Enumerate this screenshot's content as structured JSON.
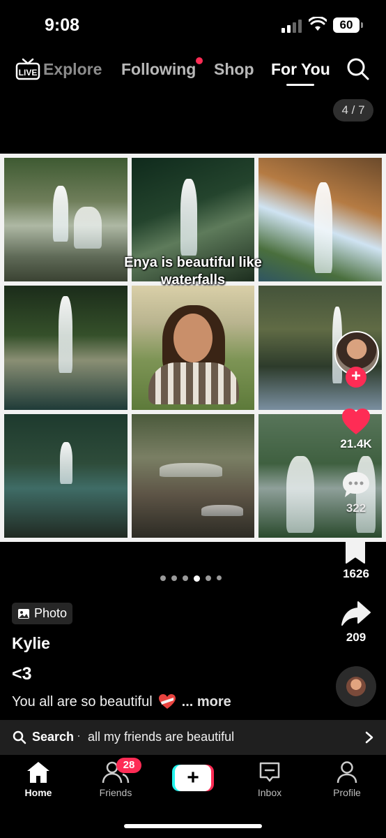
{
  "status_bar": {
    "time": "9:08",
    "battery": "60"
  },
  "top_nav": {
    "tabs": [
      {
        "label": "Explore"
      },
      {
        "label": "Following"
      },
      {
        "label": "Shop"
      },
      {
        "label": "For You"
      }
    ],
    "active_tab": "For You",
    "live_label": "LIVE"
  },
  "post": {
    "page_counter": "4 / 7",
    "overlay_text": "Enya is beautiful like waterfalls",
    "carousel": {
      "total_dots": 6,
      "active_index": 3
    },
    "badge_label": "Photo",
    "username": "Kylie",
    "title": "<3",
    "caption": "You all are so beautiful",
    "more_label": "... more"
  },
  "right_rail": {
    "likes": "21.4K",
    "comments": "322",
    "bookmarks": "1626",
    "shares": "209"
  },
  "search_strip": {
    "label": "Search",
    "separator": "·",
    "query": "all my friends are beautiful"
  },
  "bottom_nav": {
    "home": "Home",
    "friends": "Friends",
    "friends_badge": "28",
    "inbox": "Inbox",
    "profile": "Profile"
  },
  "colors": {
    "accent_red": "#fe2c55",
    "accent_cyan": "#25f4ee",
    "background": "#000000"
  }
}
